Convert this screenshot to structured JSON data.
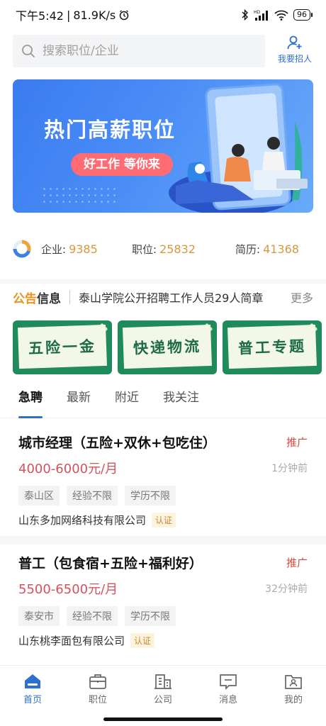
{
  "status": {
    "time": "下午5:42",
    "speed": "81.9K/s",
    "battery": "96"
  },
  "search": {
    "placeholder": "搜索职位/企业",
    "recruit_label": "我要招人"
  },
  "banner": {
    "title": "热门高薪职位",
    "subtitle": "好工作 等你来"
  },
  "stats": {
    "company_label": "企业:",
    "company_value": "9385",
    "job_label": "职位:",
    "job_value": "25832",
    "resume_label": "简历:",
    "resume_value": "41368"
  },
  "notice": {
    "tag_a": "公告",
    "tag_b": "信息",
    "text": "泰山学院公开招聘工作人员29人简章",
    "more": "更多"
  },
  "categories": [
    "五险一金",
    "快递物流",
    "普工专题"
  ],
  "tabs": [
    "急聘",
    "最新",
    "附近",
    "我关注"
  ],
  "jobs": [
    {
      "title": "城市经理（五险+双休+包吃住）",
      "promo": "推广",
      "salary": "4000-6000元/月",
      "time": "1分钟前",
      "tags": [
        "泰山区",
        "经验不限",
        "学历不限"
      ],
      "company": "山东多加网络科技有限公司",
      "verified": "认证"
    },
    {
      "title": "普工（包食宿+五险+福利好）",
      "promo": "推广",
      "salary": "5500-6500元/月",
      "time": "32分钟前",
      "tags": [
        "泰安市",
        "经验不限",
        "学历不限"
      ],
      "company": "山东桃李面包有限公司",
      "verified": "认证"
    }
  ],
  "nav": [
    "首页",
    "职位",
    "公司",
    "消息",
    "我的"
  ],
  "colors": {
    "accent": "#2f6fd1",
    "salary": "#d2535b",
    "stat_number": "#d59a3d",
    "category_bg": "#1f8a5c"
  }
}
